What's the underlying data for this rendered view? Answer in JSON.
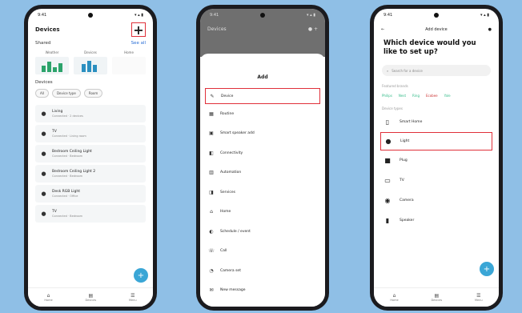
{
  "phone1": {
    "status_time": "9:41",
    "status_icons": "▾ ▴ ▮",
    "title": "Devices",
    "add_icon": "+",
    "shared_title": "Shared",
    "shared_link": "See all",
    "shortcuts": [
      {
        "label": "Weather"
      },
      {
        "label": "Devices"
      },
      {
        "label": "Home"
      }
    ],
    "devices_title": "Devices",
    "filters": [
      "All",
      "Device type",
      "Room"
    ],
    "devices": [
      {
        "name": "Living",
        "sub": "Connected · 2 devices",
        "icon": "●"
      },
      {
        "name": "TV",
        "sub": "Connected · Living room",
        "icon": "●"
      },
      {
        "name": "Bedroom Ceiling Light",
        "sub": "Connected · Bedroom",
        "icon": "●"
      },
      {
        "name": "Bedroom Ceiling Light 2",
        "sub": "Connected · Bedroom",
        "icon": "●"
      },
      {
        "name": "Desk RGB Light",
        "sub": "Connected · Office",
        "icon": "●"
      },
      {
        "name": "TV",
        "sub": "Connected · Bedroom",
        "icon": "●"
      }
    ],
    "fab_icon": "+",
    "nav": [
      {
        "icon": "⌂",
        "label": "Home"
      },
      {
        "icon": "▤",
        "label": "Devices"
      },
      {
        "icon": "☰",
        "label": "Menu"
      }
    ]
  },
  "phone2": {
    "status_time": "9:41",
    "status_icons": "▾ ▴ ▮",
    "dim_title": "Devices",
    "dim_icons": "● +",
    "sheet_title": "Add",
    "menu": [
      {
        "icon": "✎",
        "label": "Device",
        "hl": true
      },
      {
        "icon": "▦",
        "label": "Routine"
      },
      {
        "icon": "▣",
        "label": "Smart speaker add"
      },
      {
        "icon": "◧",
        "label": "Connectivity"
      },
      {
        "icon": "▥",
        "label": "Automation"
      },
      {
        "icon": "◨",
        "label": "Services"
      },
      {
        "icon": "⌂",
        "label": "Home"
      },
      {
        "icon": "◐",
        "label": "Schedule / event"
      },
      {
        "icon": "☏",
        "label": "Call"
      },
      {
        "icon": "◔",
        "label": "Camera set"
      },
      {
        "icon": "✉",
        "label": "New message"
      }
    ]
  },
  "phone3": {
    "status_time": "9:41",
    "status_icons": "▾ ▴ ▮",
    "back_icon": "←",
    "header": "Add device",
    "info_icon": "●",
    "question": "Which device would you like to set up?",
    "search_placeholder": "Search for a device",
    "brands_label": "Featured brands",
    "brands": [
      "Philips",
      "Nest",
      "Ring",
      "Ecobee",
      "Yale"
    ],
    "types_label": "Device types",
    "types": [
      {
        "icon": "▯",
        "label": "Smart Home"
      },
      {
        "icon": "●",
        "label": "Light",
        "hl": true
      },
      {
        "icon": "■",
        "label": "Plug"
      },
      {
        "icon": "▭",
        "label": "TV"
      },
      {
        "icon": "◉",
        "label": "Camera"
      },
      {
        "icon": "▮",
        "label": "Speaker"
      }
    ],
    "fab_icon": "+",
    "nav": [
      {
        "icon": "⌂",
        "label": "Home"
      },
      {
        "icon": "▤",
        "label": "Devices"
      },
      {
        "icon": "☰",
        "label": "Menu"
      }
    ]
  },
  "colors": {
    "background": "#8fbfe6",
    "highlight": "#e0303a",
    "accent": "#3aa6d6"
  }
}
